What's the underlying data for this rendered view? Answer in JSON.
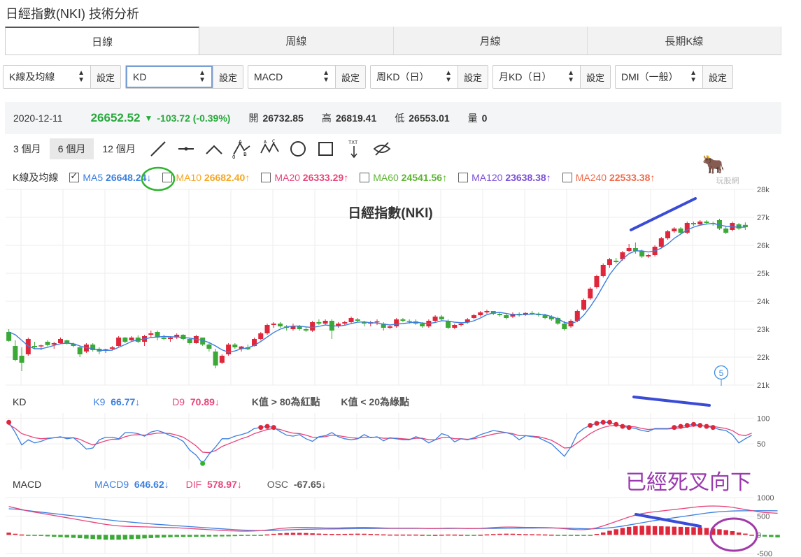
{
  "page_title": "日經指數(NKI) 技術分析",
  "tabs": [
    {
      "label": "日線"
    },
    {
      "label": "周線"
    },
    {
      "label": "月線"
    },
    {
      "label": "長期K線"
    }
  ],
  "selectors": [
    {
      "label": "K線及均線",
      "button": "設定"
    },
    {
      "label": "KD",
      "button": "設定"
    },
    {
      "label": "MACD",
      "button": "設定"
    },
    {
      "label": "周KD（日）",
      "button": "設定"
    },
    {
      "label": "月KD（日）",
      "button": "設定"
    },
    {
      "label": "DMI（一般）",
      "button": "設定"
    }
  ],
  "quote": {
    "date": "2020-12-11",
    "price": "26652.52",
    "change": "-103.72 (-0.39%)",
    "open_label": "開",
    "open": "26732.85",
    "high_label": "高",
    "high": "26819.41",
    "low_label": "低",
    "low": "26553.01",
    "vol_label": "量",
    "vol": "0"
  },
  "periods": [
    {
      "label": "3 個月"
    },
    {
      "label": "6 個月"
    },
    {
      "label": "12 個月"
    }
  ],
  "tools": [
    "line-tool-icon",
    "horizontal-line-tool-icon",
    "angle-tool-icon",
    "abc-pattern-tool-icon",
    "abcd-pattern-tool-icon",
    "circle-tool-icon",
    "rectangle-tool-icon",
    "text-tool-icon",
    "hide-icon"
  ],
  "ma_legend": {
    "title": "K線及均線",
    "items": [
      {
        "name": "MA5",
        "value": "26648.24",
        "arrow": "↓",
        "color": "#3b7fe0",
        "checked": true
      },
      {
        "name": "MA10",
        "value": "26682.40",
        "arrow": "↑",
        "color": "#f5a623",
        "checked": false
      },
      {
        "name": "MA20",
        "value": "26333.29",
        "arrow": "↑",
        "color": "#e8457a",
        "checked": false
      },
      {
        "name": "MA60",
        "value": "24541.56",
        "arrow": "↑",
        "color": "#5cb630",
        "checked": false
      },
      {
        "name": "MA120",
        "value": "23638.38",
        "arrow": "↑",
        "color": "#7b4fd6",
        "checked": false
      },
      {
        "name": "MA240",
        "value": "22533.38",
        "arrow": "↑",
        "color": "#f06a4a",
        "checked": false
      }
    ]
  },
  "watermark": "玩股網",
  "kd_legend": {
    "title": "KD",
    "k_name": "K9",
    "k_value": "66.77",
    "k_arrow": "↓",
    "d_name": "D9",
    "d_value": "70.89",
    "d_arrow": "↓",
    "note1": "K值 > 80為紅點",
    "note2": "K值 < 20為綠點"
  },
  "macd_legend": {
    "title": "MACD",
    "macd_name": "MACD9",
    "macd_value": "646.62",
    "macd_arrow": "↓",
    "dif_name": "DIF",
    "dif_value": "578.97",
    "dif_arrow": "↓",
    "osc_name": "OSC",
    "osc_value": "-67.65",
    "osc_arrow": "↓"
  },
  "annotation": "已經死叉向下",
  "marker_label": "5",
  "colors": {
    "up": "#e0263a",
    "down": "#3aa935",
    "ma5": "#3b7fe0",
    "k": "#3b7fe0",
    "d": "#e8457a",
    "blue_mark": "#3a4bd6",
    "green_mark": "#2fb52f",
    "purple_mark": "#a03aa8"
  },
  "chart_data": {
    "type": "candlestick",
    "title": "日經指數(NKI)",
    "price_axis": {
      "ticks": [
        "28k",
        "27k",
        "26k",
        "25k",
        "24k",
        "23k",
        "22k",
        "21k"
      ],
      "ylim": [
        21000,
        28000
      ]
    },
    "kd_axis": {
      "ticks": [
        "100",
        "50"
      ],
      "ylim": [
        0,
        110
      ]
    },
    "macd_axis": {
      "ticks": [
        "1000",
        "500",
        "0",
        "-500"
      ],
      "ylim": [
        -500,
        1000
      ]
    },
    "candles": [
      [
        22900,
        23000,
        22550,
        22580
      ],
      [
        22400,
        22600,
        21850,
        21900
      ],
      [
        22050,
        22350,
        21500,
        21800
      ],
      [
        22100,
        22700,
        22050,
        22650
      ],
      [
        22400,
        22550,
        22280,
        22350
      ],
      [
        22400,
        22450,
        22250,
        22420
      ],
      [
        22550,
        22600,
        22380,
        22430
      ],
      [
        22450,
        22550,
        22300,
        22500
      ],
      [
        22500,
        22700,
        22480,
        22650
      ],
      [
        22600,
        22620,
        22450,
        22500
      ],
      [
        22480,
        22520,
        22350,
        22400
      ],
      [
        22350,
        22400,
        22000,
        22100
      ],
      [
        22200,
        22500,
        22150,
        22450
      ],
      [
        22450,
        22500,
        22200,
        22250
      ],
      [
        22300,
        22350,
        22100,
        22200
      ],
      [
        22250,
        22300,
        22150,
        22280
      ],
      [
        22300,
        22400,
        22250,
        22350
      ],
      [
        22400,
        22750,
        22380,
        22700
      ],
      [
        22700,
        22720,
        22500,
        22550
      ],
      [
        22600,
        22750,
        22550,
        22700
      ],
      [
        22700,
        22780,
        22500,
        22550
      ],
      [
        22550,
        22800,
        22400,
        22750
      ],
      [
        22800,
        22950,
        22700,
        22850
      ],
      [
        22900,
        22950,
        22600,
        22700
      ],
      [
        22700,
        22800,
        22600,
        22650
      ],
      [
        22650,
        22750,
        22550,
        22700
      ],
      [
        22700,
        22850,
        22650,
        22800
      ],
      [
        22800,
        22820,
        22600,
        22650
      ],
      [
        22650,
        22700,
        22450,
        22500
      ],
      [
        22500,
        22800,
        22480,
        22750
      ],
      [
        22700,
        22700,
        22400,
        22450
      ],
      [
        22450,
        22500,
        22200,
        22300
      ],
      [
        22200,
        22300,
        21600,
        21700
      ],
      [
        21800,
        22100,
        21750,
        22050
      ],
      [
        22100,
        22500,
        22050,
        22450
      ],
      [
        22450,
        22500,
        22300,
        22350
      ],
      [
        22300,
        22400,
        22200,
        22380
      ],
      [
        22350,
        22450,
        22250,
        22280
      ],
      [
        22400,
        22700,
        22380,
        22650
      ],
      [
        22650,
        22900,
        22600,
        22850
      ],
      [
        22850,
        23200,
        22800,
        23150
      ],
      [
        23150,
        23250,
        23050,
        23200
      ],
      [
        23200,
        23250,
        23050,
        23100
      ],
      [
        23100,
        23150,
        22950,
        23050
      ],
      [
        23000,
        23200,
        22950,
        23100
      ],
      [
        23100,
        23150,
        22950,
        23000
      ],
      [
        23000,
        23100,
        22900,
        22950
      ],
      [
        22950,
        23300,
        22900,
        23250
      ],
      [
        23250,
        23350,
        23150,
        23200
      ],
      [
        23200,
        23350,
        23150,
        23300
      ],
      [
        23300,
        23350,
        22650,
        22950
      ],
      [
        23100,
        23250,
        23050,
        23200
      ],
      [
        23200,
        23300,
        23150,
        23250
      ],
      [
        23250,
        23450,
        23200,
        23400
      ],
      [
        23350,
        23400,
        23250,
        23300
      ],
      [
        23250,
        23300,
        23100,
        23200
      ],
      [
        23200,
        23300,
        23100,
        23250
      ],
      [
        23250,
        23350,
        23150,
        23280
      ],
      [
        23200,
        23250,
        22950,
        23050
      ],
      [
        23050,
        23150,
        23000,
        23100
      ],
      [
        23100,
        23400,
        23050,
        23350
      ],
      [
        23350,
        23400,
        23250,
        23300
      ],
      [
        23300,
        23350,
        23200,
        23280
      ],
      [
        23280,
        23350,
        23150,
        23200
      ],
      [
        23200,
        23250,
        23050,
        23100
      ],
      [
        23100,
        23350,
        23050,
        23300
      ],
      [
        23300,
        23500,
        23250,
        23450
      ],
      [
        23450,
        23500,
        23300,
        23350
      ],
      [
        23300,
        23350,
        23000,
        23050
      ],
      [
        23050,
        23200,
        23000,
        23150
      ],
      [
        23150,
        23250,
        23100,
        23200
      ],
      [
        23250,
        23400,
        23200,
        23350
      ],
      [
        23400,
        23550,
        23350,
        23500
      ],
      [
        23500,
        23650,
        23450,
        23600
      ],
      [
        23600,
        23700,
        23550,
        23650
      ],
      [
        23650,
        23650,
        23500,
        23550
      ],
      [
        23550,
        23600,
        23450,
        23500
      ],
      [
        23500,
        23550,
        23350,
        23400
      ],
      [
        23450,
        23600,
        23400,
        23550
      ],
      [
        23550,
        23600,
        23450,
        23500
      ],
      [
        23520,
        23600,
        23480,
        23580
      ],
      [
        23580,
        23650,
        23500,
        23550
      ],
      [
        23550,
        23600,
        23450,
        23500
      ],
      [
        23500,
        23550,
        23350,
        23400
      ],
      [
        23450,
        23500,
        23300,
        23350
      ],
      [
        23400,
        23450,
        23150,
        23200
      ],
      [
        23200,
        23300,
        22950,
        23000
      ],
      [
        23100,
        23350,
        23050,
        23300
      ],
      [
        23300,
        23700,
        23250,
        23650
      ],
      [
        23700,
        24100,
        23650,
        24050
      ],
      [
        24100,
        24500,
        24050,
        24450
      ],
      [
        24500,
        24950,
        24450,
        24900
      ],
      [
        24900,
        25350,
        24850,
        25300
      ],
      [
        25300,
        25550,
        25200,
        25500
      ],
      [
        25450,
        25550,
        25350,
        25400
      ],
      [
        25500,
        25800,
        25450,
        25750
      ],
      [
        25800,
        26050,
        25750,
        25900
      ],
      [
        25900,
        26100,
        25700,
        25800
      ],
      [
        25800,
        25850,
        25550,
        25600
      ],
      [
        25600,
        25700,
        25550,
        25650
      ],
      [
        25650,
        26000,
        25600,
        25950
      ],
      [
        25950,
        26300,
        25900,
        26250
      ],
      [
        26250,
        26550,
        26200,
        26500
      ],
      [
        26500,
        26650,
        26450,
        26600
      ],
      [
        26600,
        26650,
        26400,
        26450
      ],
      [
        26450,
        26850,
        26400,
        26800
      ],
      [
        26800,
        26850,
        26700,
        26750
      ],
      [
        26750,
        26900,
        26700,
        26850
      ],
      [
        26850,
        26900,
        26750,
        26800
      ],
      [
        26800,
        26850,
        26700,
        26780
      ],
      [
        26900,
        26950,
        26550,
        26600
      ],
      [
        26600,
        26700,
        26400,
        26450
      ],
      [
        26550,
        26850,
        26500,
        26800
      ],
      [
        26750,
        26800,
        26550,
        26600
      ],
      [
        26730,
        26820,
        26550,
        26650
      ]
    ],
    "ma5": [
      22900,
      22800,
      22600,
      22400,
      22300,
      22300,
      22350,
      22420,
      22480,
      22500,
      22480,
      22400,
      22340,
      22300,
      22250,
      22240,
      22250,
      22350,
      22450,
      22560,
      22620,
      22650,
      22700,
      22720,
      22740,
      22730,
      22720,
      22700,
      22680,
      22640,
      22600,
      22520,
      22400,
      22260,
      22180,
      22220,
      22300,
      22330,
      22420,
      22560,
      22720,
      22880,
      23000,
      23080,
      23110,
      23110,
      23080,
      23060,
      23100,
      23150,
      23120,
      23110,
      23140,
      23200,
      23250,
      23260,
      23230,
      23220,
      23180,
      23150,
      23180,
      23200,
      23230,
      23250,
      23220,
      23200,
      23240,
      23300,
      23290,
      23250,
      23230,
      23240,
      23300,
      23400,
      23520,
      23580,
      23600,
      23560,
      23520,
      23510,
      23520,
      23540,
      23540,
      23520,
      23450,
      23370,
      23240,
      23200,
      23280,
      23500,
      23800,
      24150,
      24550,
      24950,
      25250,
      25500,
      25700,
      25800,
      25800,
      25760,
      25800,
      25900,
      26050,
      26250,
      26400,
      26550,
      26650,
      26720,
      26760,
      26780,
      26730,
      26680,
      26660,
      26650,
      26648
    ],
    "k": [
      92,
      72,
      48,
      58,
      52,
      55,
      60,
      62,
      64,
      60,
      62,
      52,
      40,
      42,
      58,
      63,
      63,
      60,
      72,
      72,
      70,
      65,
      73,
      76,
      72,
      66,
      62,
      55,
      38,
      28,
      12,
      30,
      44,
      60,
      60,
      65,
      68,
      72,
      80,
      82,
      84,
      82,
      74,
      67,
      65,
      68,
      60,
      55,
      64,
      66,
      72,
      64,
      60,
      58,
      60,
      68,
      62,
      64,
      56,
      62,
      60,
      58,
      58,
      64,
      60,
      52,
      58,
      70,
      66,
      54,
      60,
      58,
      62,
      68,
      72,
      76,
      74,
      72,
      68,
      58,
      66,
      64,
      62,
      56,
      50,
      38,
      26,
      44,
      70,
      80,
      86,
      90,
      92,
      92,
      88,
      84,
      82,
      80,
      76,
      74,
      80,
      80,
      80,
      82,
      84,
      86,
      88,
      86,
      84,
      82,
      78,
      76,
      68,
      52,
      60,
      66.77
    ],
    "d": [
      88,
      80,
      70,
      66,
      62,
      60,
      61,
      62,
      63,
      62,
      62,
      59,
      53,
      48,
      52,
      56,
      59,
      59,
      64,
      67,
      68,
      67,
      69,
      71,
      71,
      70,
      67,
      63,
      55,
      46,
      34,
      33,
      37,
      45,
      50,
      55,
      60,
      64,
      70,
      74,
      78,
      80,
      78,
      74,
      71,
      70,
      67,
      63,
      63,
      64,
      67,
      66,
      64,
      62,
      61,
      63,
      63,
      63,
      61,
      61,
      61,
      60,
      59,
      61,
      61,
      58,
      58,
      62,
      63,
      60,
      60,
      59,
      60,
      63,
      66,
      69,
      71,
      72,
      70,
      66,
      66,
      65,
      64,
      61,
      57,
      50,
      42,
      43,
      52,
      61,
      70,
      77,
      82,
      85,
      86,
      86,
      84,
      83,
      80,
      78,
      79,
      79,
      79,
      80,
      81,
      83,
      85,
      85,
      85,
      84,
      82,
      80,
      76,
      68,
      66,
      70.89
    ],
    "dif": [
      760,
      720,
      680,
      640,
      610,
      580,
      550,
      520,
      490,
      460,
      430,
      400,
      370,
      340,
      310,
      280,
      260,
      240,
      230,
      225,
      220,
      215,
      210,
      205,
      200,
      195,
      190,
      180,
      170,
      160,
      150,
      140,
      130,
      120,
      110,
      105,
      100,
      100,
      105,
      115,
      130,
      150,
      170,
      185,
      195,
      200,
      200,
      195,
      190,
      185,
      185,
      185,
      190,
      195,
      200,
      200,
      195,
      190,
      185,
      180,
      180,
      180,
      180,
      180,
      175,
      170,
      170,
      175,
      180,
      180,
      175,
      170,
      170,
      175,
      185,
      195,
      205,
      210,
      210,
      205,
      200,
      200,
      198,
      195,
      190,
      180,
      165,
      150,
      140,
      140,
      155,
      190,
      240,
      300,
      360,
      420,
      480,
      530,
      570,
      600,
      620,
      640,
      660,
      680,
      700,
      720,
      740,
      760,
      770,
      775,
      770,
      760,
      740,
      710,
      680,
      650,
      620,
      600,
      590,
      579
    ],
    "macd": [
      700,
      690,
      670,
      650,
      630,
      610,
      590,
      570,
      550,
      530,
      510,
      490,
      470,
      450,
      430,
      410,
      390,
      370,
      355,
      340,
      325,
      310,
      295,
      282,
      270,
      258,
      246,
      234,
      222,
      210,
      198,
      186,
      174,
      162,
      150,
      140,
      130,
      122,
      118,
      117,
      118,
      122,
      128,
      134,
      140,
      146,
      150,
      153,
      156,
      158,
      160,
      162,
      164,
      166,
      168,
      170,
      171,
      172,
      172,
      172,
      172,
      172,
      172,
      172,
      172,
      171,
      170,
      170,
      171,
      172,
      172,
      171,
      171,
      171,
      172,
      174,
      176,
      178,
      180,
      181,
      182,
      183,
      184,
      184,
      184,
      183,
      180,
      176,
      170,
      165,
      162,
      165,
      175,
      190,
      210,
      235,
      265,
      295,
      325,
      355,
      385,
      410,
      435,
      460,
      485,
      510,
      535,
      560,
      585,
      605,
      620,
      632,
      640,
      645,
      646,
      647,
      647,
      647,
      647,
      646.62
    ]
  }
}
